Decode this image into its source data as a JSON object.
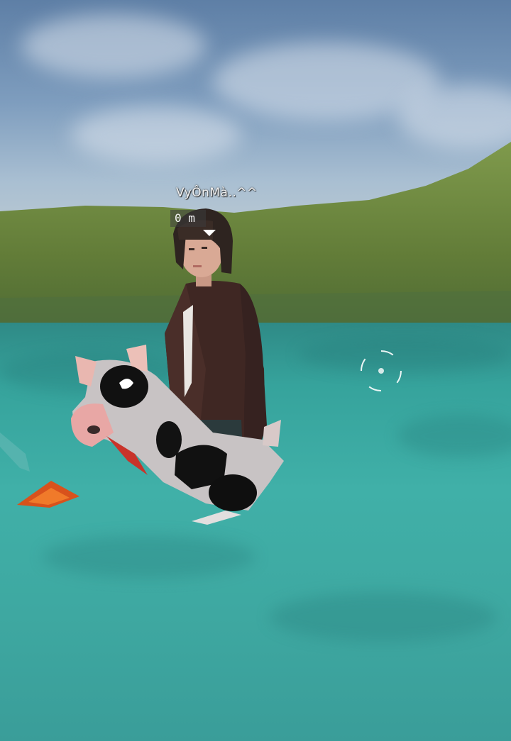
{
  "hud": {
    "player_name": "VyÔnMà..^^",
    "distance": "0 m"
  },
  "icons": {
    "crosshair": "aim-reticle-icon",
    "marker": "player-marker-arrow-icon"
  },
  "colors": {
    "water": "#3ea8a1",
    "grass": "#6e8a3e",
    "sky": "#7e9dbe"
  }
}
